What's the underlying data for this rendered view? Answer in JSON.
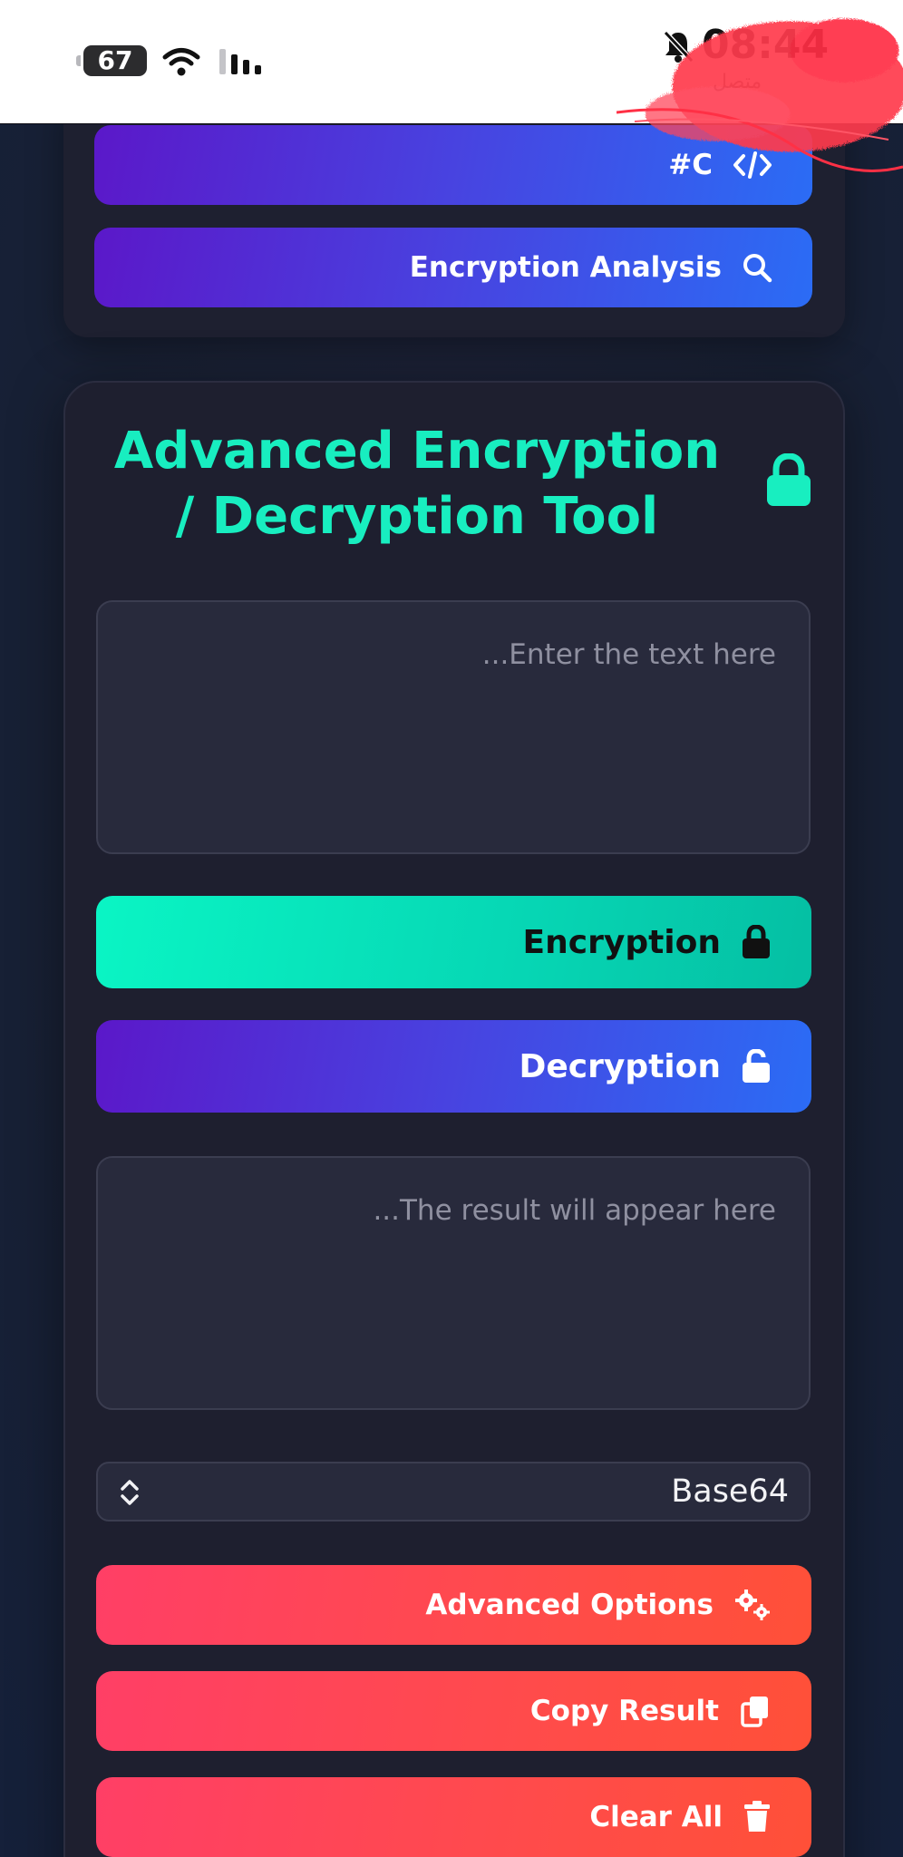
{
  "status_bar": {
    "battery": "67",
    "time": "08:44",
    "carrier": "متصل"
  },
  "top_card": {
    "code_button_label": "#C",
    "analysis_button_label": "Encryption Analysis"
  },
  "tool": {
    "title": "Advanced Encryption / Decryption Tool",
    "input_placeholder": "...Enter the text here",
    "encrypt_label": "Encryption",
    "decrypt_label": "Decryption",
    "output_placeholder": "...The result will appear here",
    "method_selected": "Base64",
    "advanced_options_label": "Advanced Options",
    "copy_result_label": "Copy Result",
    "clear_all_label": "Clear All"
  },
  "colors": {
    "accent_teal": "#18eec0",
    "purple_start": "#5b18c9",
    "purple_end": "#2b6cf5",
    "coral": "#ff4555",
    "card_bg": "#1e1f2f"
  },
  "icons": [
    "battery-icon",
    "wifi-icon",
    "signal-icon",
    "bell-slash-icon",
    "code-icon",
    "search-icon",
    "lock-icon",
    "unlock-icon",
    "chevron-updown-icon",
    "gears-icon",
    "copy-icon",
    "trash-icon"
  ]
}
